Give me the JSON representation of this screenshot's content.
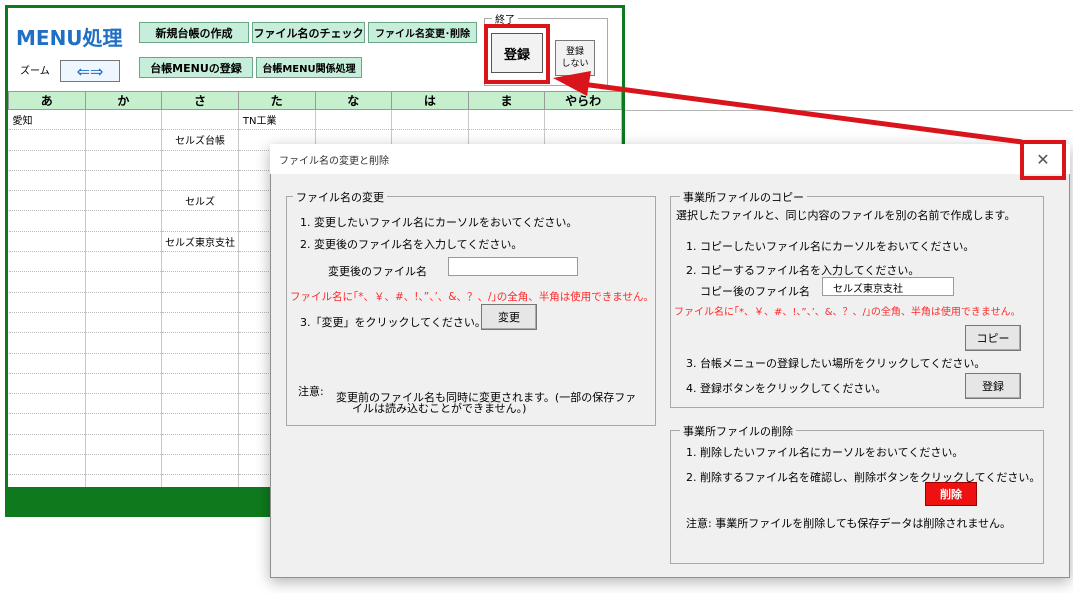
{
  "sheet": {
    "title": "MENU処理",
    "buttons": {
      "new_ledger": "新規台帳の作成",
      "file_check": "ファイル名のチェック",
      "rename_delete": "ファイル名変更･削除",
      "ledger_menu_register": "台帳MENUの登録",
      "ledger_menu_related": "台帳MENU関係処理"
    },
    "zoom_label": "ズーム",
    "zoom_arrows": "⇐⇒",
    "end_group_label": "終了",
    "register_button": "登録",
    "no_register_line1": "登録",
    "no_register_line2": "しない",
    "columns": [
      "あ",
      "か",
      "さ",
      "た",
      "な",
      "は",
      "ま",
      "やらわ"
    ],
    "cells": {
      "r1_a": "愛知",
      "r1_ta": "TN工業",
      "r2_sa": "セルズ台帳",
      "r5_sa": "セルズ",
      "r7_sa": "セルズ東京支社"
    }
  },
  "dialog": {
    "title": "ファイル名の変更と削除",
    "close_glyph": "✕",
    "rename": {
      "label": "ファイル名の変更",
      "step1": "1. 変更したいファイル名にカーソルをおいてください。",
      "step2": "2. 変更後のファイル名を入力してください。",
      "field_label": "変更後のファイル名",
      "field_value": "",
      "warning": "ファイル名に｢*、￥、#、!、”、’、&、？、/｣の全角、半角は使用できません。",
      "step3": "3.「変更」をクリックしてください。",
      "change_button": "変更",
      "note_label": "注意:",
      "note_line1": "変更前のファイル名も同時に変更されます。(一部の保存ファ",
      "note_line2": "イルは読み込むことができません。)"
    },
    "copy": {
      "label": "事業所ファイルのコピー",
      "desc": "選択したファイルと、同じ内容のファイルを別の名前で作成します。",
      "step1": "1. コピーしたいファイル名にカーソルをおいてください。",
      "step2": "2. コピーするファイル名を入力してください。",
      "field_label": "コピー後のファイル名",
      "field_value": "セルズ東京支社",
      "warning": "ファイル名に｢*、￥、#、!、”、’、&、？、/｣の全角、半角は使用できません。",
      "copy_button": "コピー",
      "step3": "3. 台帳メニューの登録したい場所をクリックしてください。",
      "step4": "4. 登録ボタンをクリックしてください。",
      "register_button": "登録"
    },
    "delete": {
      "label": "事業所ファイルの削除",
      "step1": "1. 削除したいファイル名にカーソルをおいてください。",
      "step2": "2. 削除するファイル名を確認し、削除ボタンをクリックしてください。",
      "delete_button": "削除",
      "note": "注意:  事業所ファイルを削除しても保存データは削除されません。"
    }
  },
  "colors": {
    "sheet_green": "#0f7a1d",
    "title_blue": "#1f6fc4",
    "highlight_red": "#d9141b",
    "warning_red": "#ff2a2a"
  }
}
